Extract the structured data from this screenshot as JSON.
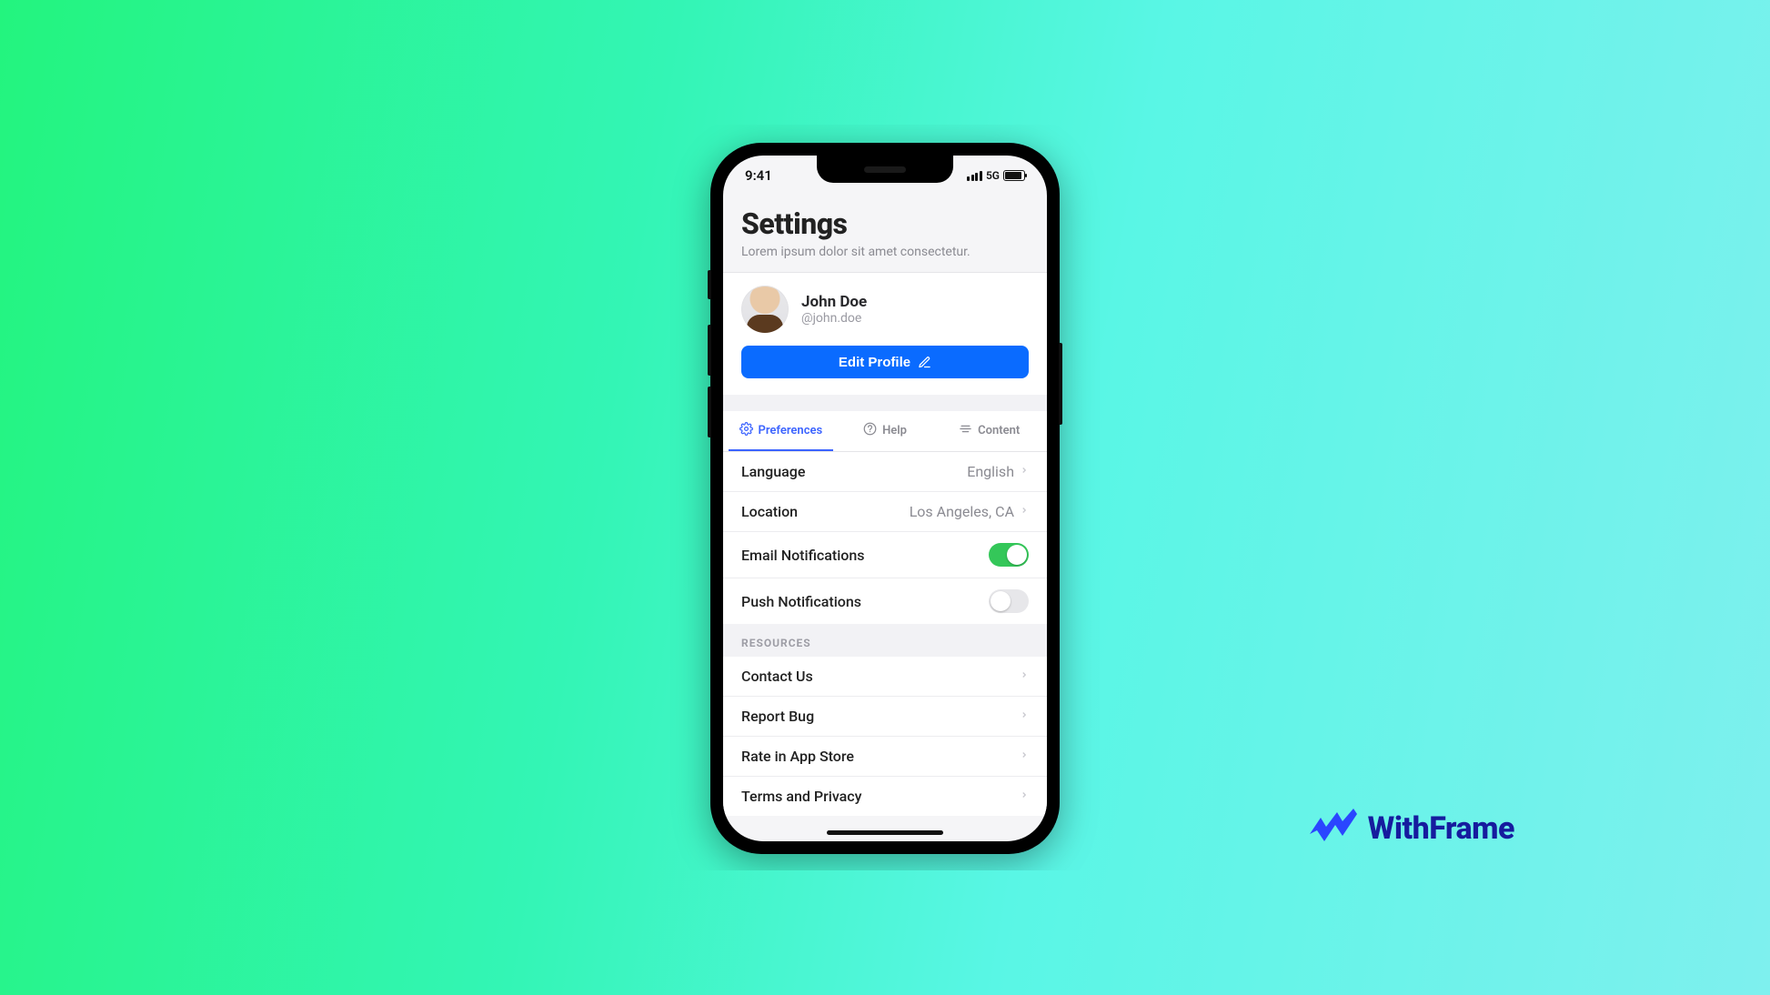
{
  "status_bar": {
    "time": "9:41",
    "network_label": "5G"
  },
  "header": {
    "title": "Settings",
    "subtitle": "Lorem ipsum dolor sit amet consectetur."
  },
  "profile": {
    "name": "John Doe",
    "handle": "@john.doe",
    "edit_label": "Edit Profile"
  },
  "tabs": [
    {
      "label": "Preferences",
      "active": true
    },
    {
      "label": "Help",
      "active": false
    },
    {
      "label": "Content",
      "active": false
    }
  ],
  "preferences": {
    "language": {
      "label": "Language",
      "value": "English"
    },
    "location": {
      "label": "Location",
      "value": "Los Angeles, CA"
    },
    "email_notifications": {
      "label": "Email Notifications",
      "on": true
    },
    "push_notifications": {
      "label": "Push Notifications",
      "on": false
    }
  },
  "resources": {
    "group_title": "RESOURCES",
    "items": [
      {
        "label": "Contact Us"
      },
      {
        "label": "Report Bug"
      },
      {
        "label": "Rate in App Store"
      },
      {
        "label": "Terms and Privacy"
      }
    ]
  },
  "brand": {
    "name": "WithFrame"
  }
}
